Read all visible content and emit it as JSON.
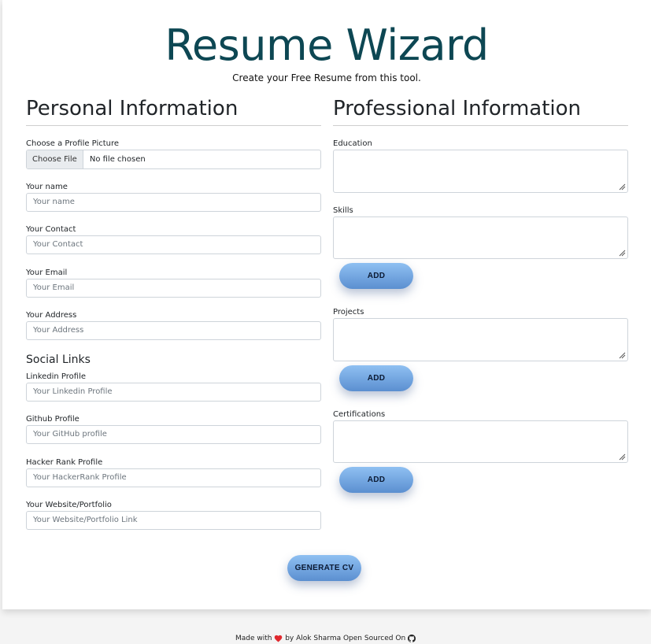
{
  "header": {
    "title": "Resume Wizard",
    "subtitle": "Create your Free Resume from this tool."
  },
  "personal": {
    "heading": "Personal Information",
    "profile_picture": {
      "label": "Choose a Profile Picture",
      "button_label": "Choose File",
      "status": "No file chosen"
    },
    "fields": [
      {
        "label": "Your name",
        "placeholder": "Your name"
      },
      {
        "label": "Your Contact",
        "placeholder": "Your Contact"
      },
      {
        "label": "Your Email",
        "placeholder": "Your Email"
      },
      {
        "label": "Your Address",
        "placeholder": "Your Address"
      }
    ],
    "social": {
      "heading": "Social Links",
      "fields": [
        {
          "label": "Linkedin Profile",
          "placeholder": "Your Linkedin Profile"
        },
        {
          "label": "Github Profile",
          "placeholder": "Your GitHub profile"
        },
        {
          "label": "Hacker Rank Profile",
          "placeholder": "Your HackerRank Profile"
        },
        {
          "label": "Your Website/Portfolio",
          "placeholder": "Your Website/Portfolio Link"
        }
      ]
    }
  },
  "professional": {
    "heading": "Professional Information",
    "education": {
      "label": "Education"
    },
    "skills": {
      "label": "Skills",
      "add_label": "ADD"
    },
    "projects": {
      "label": "Projects",
      "add_label": "ADD"
    },
    "certifications": {
      "label": "Certifications",
      "add_label": "ADD"
    }
  },
  "generate_label": "GENERATE CV",
  "footer": {
    "made_with": "Made with",
    "by": "by Alok Sharma Open Sourced On",
    "heart_icon": "heart-icon",
    "github_icon": "github-icon"
  },
  "colors": {
    "title": "#0d4753",
    "button_gradient_top": "#8fc0f2",
    "button_gradient_bottom": "#5b8fd0",
    "heart": "#e0282e"
  }
}
